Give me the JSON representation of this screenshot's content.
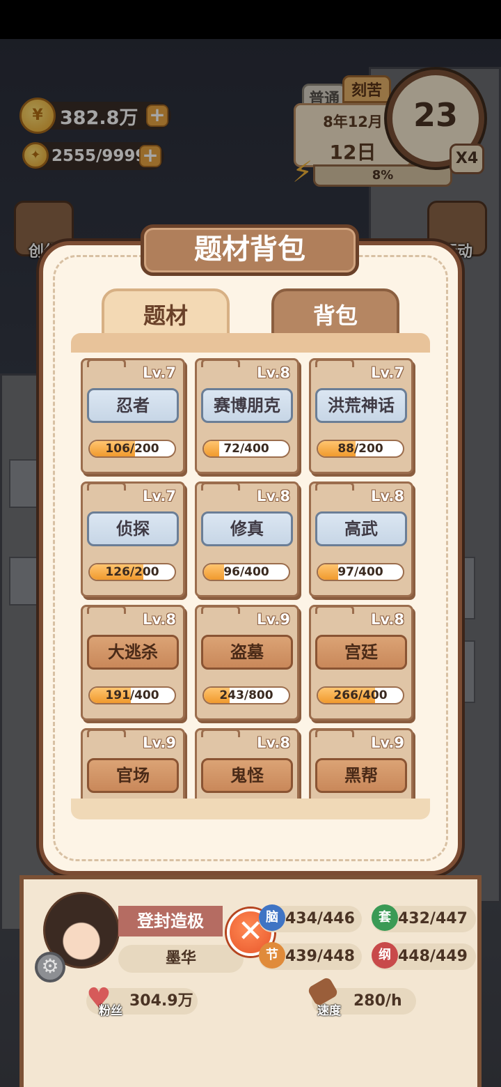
{
  "currency": {
    "coins": "382.8万",
    "energy": "2555/9999",
    "coin_glyph": "¥"
  },
  "calendar": {
    "mode_normal": "普通",
    "mode_hard": "刻苦",
    "year_month": "8年12月",
    "day": "12日",
    "clock_value": "23",
    "speed_multiplier": "X4",
    "progress_label": "8%",
    "progress_fraction": 0.08
  },
  "side_buttons": {
    "create": "创作",
    "action": "行动"
  },
  "modal": {
    "title": "题材背包",
    "tabs": [
      {
        "label": "题材",
        "active": true
      },
      {
        "label": "背包",
        "active": false
      }
    ],
    "cards": [
      {
        "name": "忍者",
        "level": "Lv.7",
        "progress": "106/200",
        "fraction": 0.53,
        "style": "blue"
      },
      {
        "name": "赛博朋克",
        "level": "Lv.8",
        "progress": "72/400",
        "fraction": 0.18,
        "style": "blue"
      },
      {
        "name": "洪荒神话",
        "level": "Lv.7",
        "progress": "88/200",
        "fraction": 0.44,
        "style": "blue"
      },
      {
        "name": "侦探",
        "level": "Lv.7",
        "progress": "126/200",
        "fraction": 0.63,
        "style": "blue"
      },
      {
        "name": "修真",
        "level": "Lv.8",
        "progress": "96/400",
        "fraction": 0.24,
        "style": "blue"
      },
      {
        "name": "高武",
        "level": "Lv.8",
        "progress": "97/400",
        "fraction": 0.24,
        "style": "blue"
      },
      {
        "name": "大逃杀",
        "level": "Lv.8",
        "progress": "191/400",
        "fraction": 0.48,
        "style": "brown"
      },
      {
        "name": "盗墓",
        "level": "Lv.9",
        "progress": "243/800",
        "fraction": 0.3,
        "style": "brown"
      },
      {
        "name": "宫廷",
        "level": "Lv.8",
        "progress": "266/400",
        "fraction": 0.67,
        "style": "brown"
      },
      {
        "name": "官场",
        "level": "Lv.9",
        "progress": "",
        "fraction": 0,
        "style": "brown"
      },
      {
        "name": "鬼怪",
        "level": "Lv.8",
        "progress": "",
        "fraction": 0,
        "style": "brown"
      },
      {
        "name": "黑帮",
        "level": "Lv.9",
        "progress": "",
        "fraction": 0,
        "style": "brown"
      }
    ]
  },
  "player": {
    "rank": "登封造极",
    "name": "墨华",
    "fans_label": "粉丝",
    "fans": "304.9万",
    "speed_label": "速度",
    "speed": "280/h",
    "stats": [
      {
        "icon": "脑",
        "value": "434/446",
        "color": "#3f74c4"
      },
      {
        "icon": "套",
        "value": "432/447",
        "color": "#3a9a55"
      },
      {
        "icon": "节",
        "value": "439/448",
        "color": "#e08b3a"
      },
      {
        "icon": "纲",
        "value": "448/449",
        "color": "#c84a4a"
      }
    ]
  }
}
